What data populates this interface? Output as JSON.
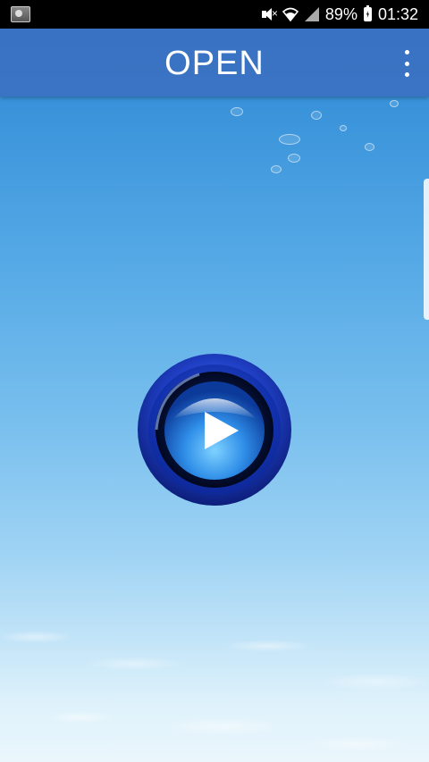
{
  "status_bar": {
    "battery": "89%",
    "time": "01:32",
    "icons": [
      "notification-image-icon",
      "mute-icon",
      "wifi-icon",
      "signal-icon",
      "battery-charging-icon"
    ]
  },
  "app_bar": {
    "title": "OPEN",
    "menu_icon": "overflow-menu-icon"
  },
  "main": {
    "play_button_icon": "play-icon"
  },
  "colors": {
    "app_bar": "#3c6cbe",
    "sky_top": "#2f86d2",
    "sky_bottom": "#eaf6fc",
    "button_ring": "#1f3fc4",
    "button_glow": "#3fa6f0"
  }
}
